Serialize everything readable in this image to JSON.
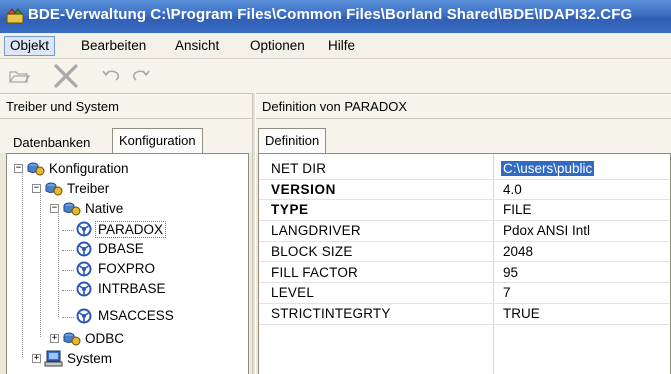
{
  "window": {
    "title": "BDE-Verwaltung  C:\\Program Files\\Common Files\\Borland Shared\\BDE\\IDAPI32.CFG"
  },
  "menu": {
    "items": [
      {
        "label": "Objekt"
      },
      {
        "label": "Bearbeiten"
      },
      {
        "label": "Ansicht"
      },
      {
        "label": "Optionen"
      },
      {
        "label": "Hilfe"
      }
    ]
  },
  "toolbar": {
    "icons": [
      "open-icon",
      "delete-icon",
      "undo-icon",
      "redo-icon"
    ]
  },
  "left_panel": {
    "header": "Treiber und System",
    "tabs": [
      {
        "label": "Datenbanken",
        "selected": false
      },
      {
        "label": "Konfiguration",
        "selected": true
      }
    ],
    "tree": {
      "root": "Konfiguration",
      "treiber": "Treiber",
      "native": "Native",
      "drivers": [
        "PARADOX",
        "DBASE",
        "FOXPRO",
        "INTRBASE",
        "MSACCESS"
      ],
      "odbc": "ODBC",
      "system": "System"
    }
  },
  "right_panel": {
    "header": "Definition von PARADOX",
    "tabs": [
      {
        "label": "Definition",
        "selected": true
      }
    ],
    "properties": [
      {
        "key": "NET DIR",
        "value": "C:\\users\\public",
        "bold": false
      },
      {
        "key": "VERSION",
        "value": "4.0",
        "bold": true
      },
      {
        "key": "TYPE",
        "value": "FILE",
        "bold": true
      },
      {
        "key": "LANGDRIVER",
        "value": "Pdox ANSI Intl",
        "bold": false
      },
      {
        "key": "BLOCK SIZE",
        "value": "2048",
        "bold": false
      },
      {
        "key": "FILL FACTOR",
        "value": "95",
        "bold": false
      },
      {
        "key": "LEVEL",
        "value": "7",
        "bold": false
      },
      {
        "key": "STRICTINTEGRTY",
        "value": "TRUE",
        "bold": false
      }
    ]
  },
  "colors": {
    "titlebar": "#3c6fc4",
    "selection": "#316ac5",
    "driver_icon": "#2a57b8"
  }
}
